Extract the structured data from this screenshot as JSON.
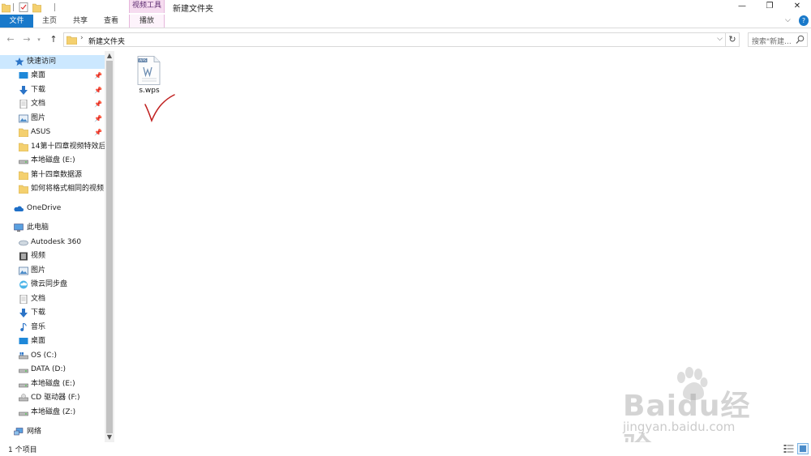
{
  "window": {
    "title": "新建文件夹",
    "context_tab_group": "视频工具",
    "minimize": "—",
    "maximize": "❐",
    "close": "✕"
  },
  "ribbon": {
    "tabs": [
      {
        "label": "文件"
      },
      {
        "label": "主页"
      },
      {
        "label": "共享"
      },
      {
        "label": "查看"
      },
      {
        "label": "播放"
      }
    ],
    "help": "?"
  },
  "address": {
    "path": "新建文件夹",
    "search_placeholder": "搜索\"新建..."
  },
  "nav_pane": {
    "quick_access_label": "快速访问",
    "quick_access": [
      {
        "label": "桌面",
        "icon": "desktop-icon",
        "pinned": true
      },
      {
        "label": "下载",
        "icon": "download-icon",
        "pinned": true
      },
      {
        "label": "文档",
        "icon": "document-icon",
        "pinned": true
      },
      {
        "label": "图片",
        "icon": "pictures-icon",
        "pinned": true
      },
      {
        "label": "ASUS",
        "icon": "folder-icon",
        "pinned": true
      },
      {
        "label": "14第十四章视频特效后",
        "icon": "folder-icon",
        "pinned": false
      },
      {
        "label": "本地磁盘 (E:)",
        "icon": "drive-icon",
        "pinned": false
      },
      {
        "label": "第十四章数据源",
        "icon": "folder-icon",
        "pinned": false
      },
      {
        "label": "如何将格式相同的视频",
        "icon": "folder-icon",
        "pinned": false
      }
    ],
    "onedrive_label": "OneDrive",
    "this_pc_label": "此电脑",
    "this_pc": [
      {
        "label": "Autodesk 360",
        "icon": "cloud-drive-icon"
      },
      {
        "label": "视频",
        "icon": "video-icon"
      },
      {
        "label": "图片",
        "icon": "pictures-icon"
      },
      {
        "label": "微云同步盘",
        "icon": "weiyun-icon"
      },
      {
        "label": "文档",
        "icon": "document-icon"
      },
      {
        "label": "下载",
        "icon": "download-icon"
      },
      {
        "label": "音乐",
        "icon": "music-icon"
      },
      {
        "label": "桌面",
        "icon": "desktop-icon"
      },
      {
        "label": "OS (C:)",
        "icon": "windows-drive-icon"
      },
      {
        "label": "DATA (D:)",
        "icon": "drive-icon"
      },
      {
        "label": "本地磁盘 (E:)",
        "icon": "drive-icon"
      },
      {
        "label": "CD 驱动器 (F:)",
        "icon": "cd-drive-icon"
      },
      {
        "label": "本地磁盘 (Z:)",
        "icon": "drive-icon"
      }
    ],
    "network_label": "网络"
  },
  "content": {
    "files": [
      {
        "name": "s.wps",
        "icon": "wps-document-icon",
        "badge": "WPS"
      }
    ]
  },
  "status": {
    "item_count": "1 个项目"
  },
  "watermark": {
    "logo": "Baidu经验",
    "url": "jingyan.baidu.com"
  },
  "colors": {
    "file_tab": "#1979ca",
    "context_tab": "#f6dcf0",
    "selection": "#cce8ff",
    "folder": "#f4d06f",
    "checkmark": "#c0201f"
  }
}
